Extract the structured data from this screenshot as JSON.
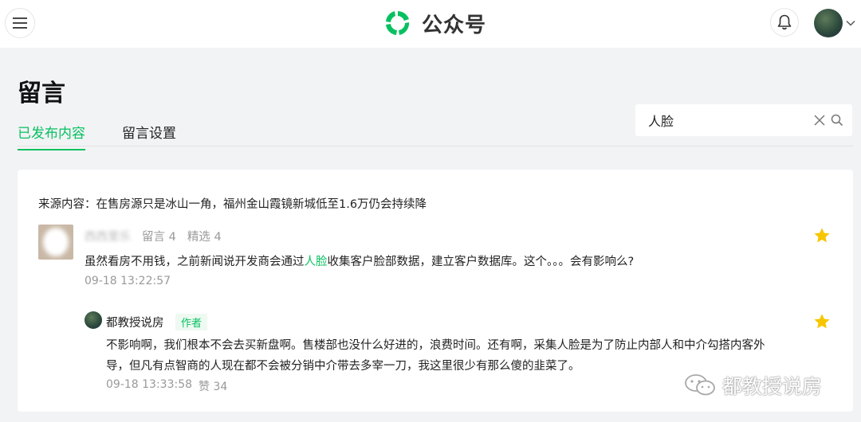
{
  "header": {
    "brand_name": "公众号",
    "brand_color": "#07c160",
    "menu_icon": "hamburger-menu-icon",
    "bell_icon": "bell-icon",
    "avatar_dropdown_icon": "chevron-down-icon"
  },
  "page": {
    "title": "留言",
    "tabs": [
      {
        "label": "已发布内容",
        "active": true
      },
      {
        "label": "留言设置",
        "active": false
      }
    ]
  },
  "search": {
    "value": "人脸",
    "clear_icon": "close-icon",
    "search_icon": "search-icon"
  },
  "card": {
    "source_label": "来源内容：",
    "source_title": "在售房源只是冰山一角，福州金山霞镜新城低至1.6万仍会持续降",
    "comment": {
      "nickname": "西西里乐",
      "comment_count": "留言 4",
      "featured_count": "精选 4",
      "text_before": "虽然看房不用钱，之前新闻说开发商会通过",
      "text_highlight": "人脸",
      "text_after": "收集客户脸部数据，建立客户数据库。这个。。。会有影响么?",
      "time": "09-18 13:22:57",
      "starred": true
    },
    "reply": {
      "author_name": "都教授说房",
      "author_badge": "作者",
      "text": "不影响啊，我们根本不会去买新盘啊。售楼部也没什么好进的，浪费时间。还有啊，采集人脸是为了防止内部人和中介勾搭内客外导，但凡有点智商的人现在都不会被分销中介带去多宰一刀，我这里很少有那么傻的韭菜了。",
      "time": "09-18 13:33:58",
      "likes": "赞 34",
      "starred": true
    }
  },
  "watermark": {
    "text": "都教授说房",
    "icon": "wechat-icon"
  },
  "colors": {
    "accent": "#07c160",
    "star": "#f7c600",
    "background": "#f2f3f5"
  }
}
